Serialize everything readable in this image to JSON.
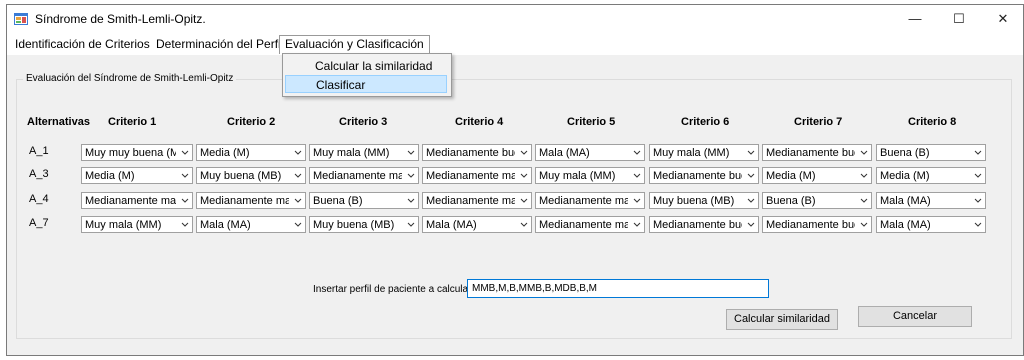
{
  "window": {
    "title": "Síndrome de Smith-Lemli-Opitz.",
    "minimize_glyph": "—",
    "maximize_glyph": "☐",
    "close_glyph": "✕"
  },
  "menubar": {
    "items": [
      {
        "label": "Identificación de Criterios"
      },
      {
        "label": "Determinación del Perfil"
      },
      {
        "label": "Evaluación y Clasificación"
      }
    ],
    "dropdown": [
      {
        "label": "Calcular la similaridad"
      },
      {
        "label": "Clasificar"
      }
    ]
  },
  "group": {
    "title": "Evaluación del Síndrome de Smith-Lemli-Opitz"
  },
  "table": {
    "corner_header": "Alternativas",
    "criteria": [
      "Criterio 1",
      "Criterio 2",
      "Criterio 3",
      "Criterio 4",
      "Criterio 5",
      "Criterio 6",
      "Criterio 7",
      "Criterio 8"
    ],
    "rows": [
      {
        "label": "A_1",
        "values": [
          "Muy muy buena (MM",
          "Media (M)",
          "Muy mala (MM)",
          "Medianamente buen",
          "Mala (MA)",
          "Muy mala (MM)",
          "Medianamente buen",
          "Buena (B)"
        ]
      },
      {
        "label": "A_3",
        "values": [
          "Media (M)",
          "Muy buena (MB)",
          "Medianamente mala",
          "Medianamente mala",
          "Muy mala (MM)",
          "Medianamente buen",
          "Media (M)",
          "Media (M)"
        ]
      },
      {
        "label": "A_4",
        "values": [
          "Medianamente mala",
          "Medianamente mala",
          "Buena (B)",
          "Medianamente mala",
          "Medianamente mala",
          "Muy buena (MB)",
          "Buena (B)",
          "Mala (MA)"
        ]
      },
      {
        "label": "A_7",
        "values": [
          "Muy mala (MM)",
          "Mala (MA)",
          "Muy buena (MB)",
          "Mala (MA)",
          "Medianamente mala",
          "Medianamente buen",
          "Medianamente buen",
          "Mala (MA)"
        ]
      }
    ]
  },
  "profile": {
    "label": "Insertar perfil de paciente a calcular",
    "value": "MMB,M,B,MMB,B,MDB,B,M"
  },
  "buttons": {
    "calculate": "Calcular similaridad",
    "cancel": "Cancelar"
  },
  "colors": {
    "window_bg": "#f0f0f0",
    "highlight": "#cce8ff",
    "focus_border": "#0078d7"
  },
  "icons": {
    "app": "app-window-icon",
    "combo_arrow": "chevron-down-icon"
  }
}
